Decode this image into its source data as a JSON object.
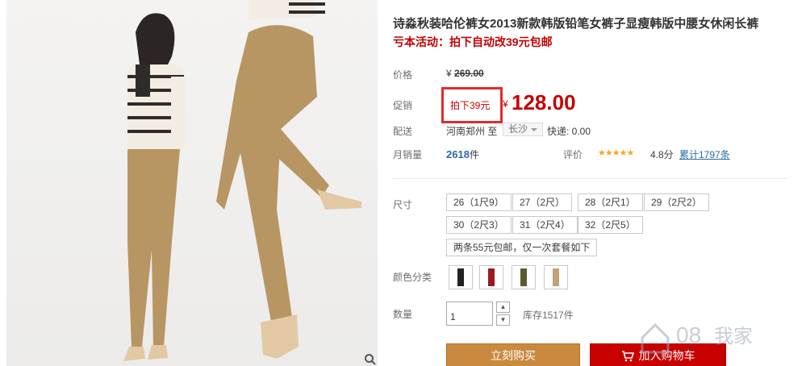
{
  "product": {
    "title": "诗淼秋装哈伦裤女2013新款韩版铅笔女裤子显瘦韩版中腰女休闲长裤",
    "promo_line": "亏本活动：拍下自动改39元包邮"
  },
  "price": {
    "label": "价格",
    "currency": "¥",
    "original": "269.00"
  },
  "promotion": {
    "label": "促销",
    "tag": "拍下39元",
    "currency": "¥",
    "price": "128.00"
  },
  "shipping": {
    "label": "配送",
    "from": "河南郑州 至",
    "to": "长沙",
    "fee": "快递: 0.00"
  },
  "sales": {
    "label": "月销量",
    "count": "2618",
    "unit": "件",
    "rating_label": "评价",
    "stars": "★★★★★",
    "score": "4.8分",
    "reviews": "累计1797条"
  },
  "sizes": {
    "label": "尺寸",
    "options": [
      "26（1尺9）",
      "27（2尺）",
      "28（2尺1）",
      "29（2尺2）",
      "30（2尺3）",
      "31（2尺4）",
      "32（2尺5）",
      "两条55元包邮，仅一次套餐如下"
    ]
  },
  "colors": {
    "label": "颜色分类",
    "swatches": [
      "black",
      "red",
      "olive",
      "khaki"
    ]
  },
  "quantity": {
    "label": "数量",
    "value": "1",
    "stock": "库存1517件"
  },
  "actions": {
    "buy_now": "立刻购买",
    "add_to_cart": "加入购物车"
  },
  "colors_theme": {
    "accent_red": "#c40000",
    "buy_orange": "#c98a3f",
    "link_blue": "#2a6aa8"
  }
}
